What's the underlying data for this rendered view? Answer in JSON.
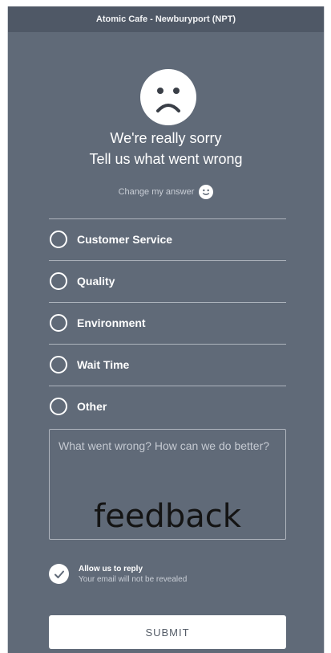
{
  "header": {
    "title": "Atomic Cafe - Newburyport (NPT)"
  },
  "icons": {
    "face": "sad-face-icon",
    "change": "smiley-icon",
    "reply": "checkmark-icon"
  },
  "message": {
    "line1": "We're really sorry",
    "line2": "Tell us what went wrong",
    "change_label": "Change my answer"
  },
  "options": [
    {
      "label": "Customer Service"
    },
    {
      "label": "Quality"
    },
    {
      "label": "Environment"
    },
    {
      "label": "Wait Time"
    },
    {
      "label": "Other"
    }
  ],
  "feedback": {
    "placeholder": "What went wrong? How can we do better?",
    "overlay_text": "feedback"
  },
  "reply": {
    "title": "Allow us to reply",
    "subtitle": "Your email will not be revealed",
    "checked": true
  },
  "submit_label": "SUBMIT",
  "colors": {
    "panel": "#606a78",
    "header": "#4f5866",
    "accent": "#ffffff"
  }
}
